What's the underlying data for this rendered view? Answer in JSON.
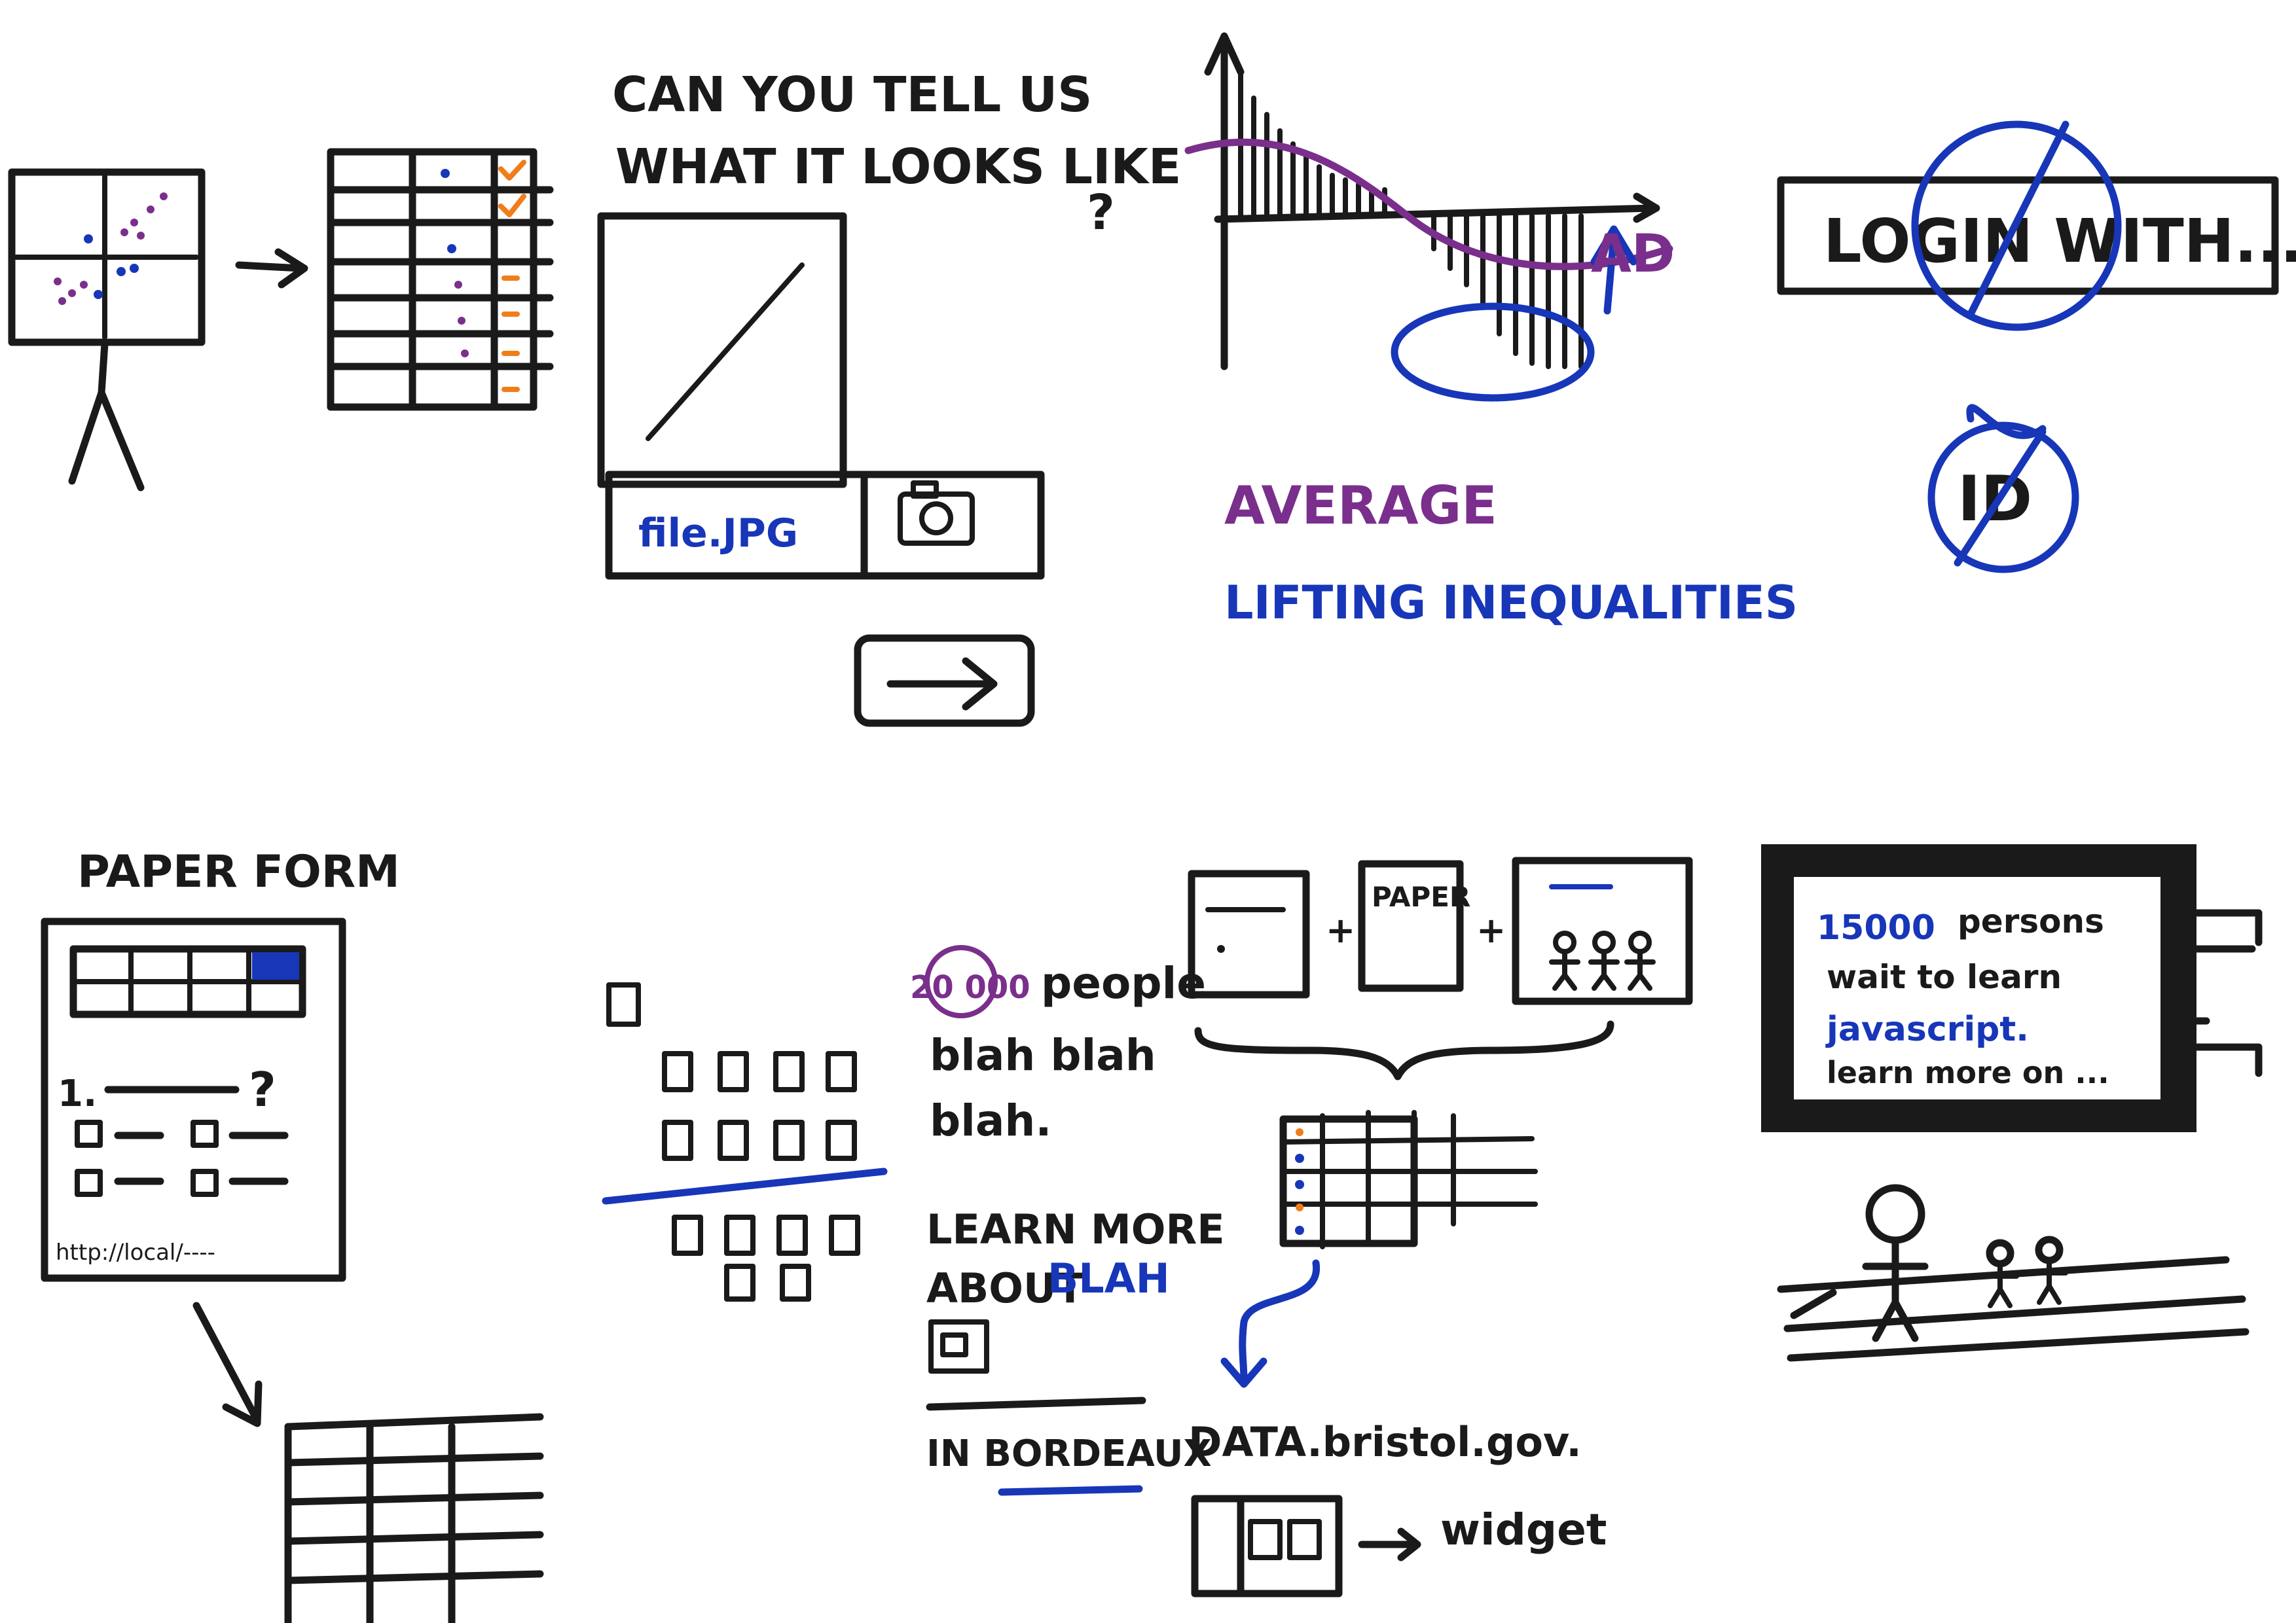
{
  "colors": {
    "ink": "#1a1a1a",
    "blue": "#1736b8",
    "purple": "#7a2f8c",
    "orange": "#f07d1a"
  },
  "sketch1": {
    "question_line1": "CAN YOU TELL US",
    "question_line2": "WHAT IT LOOKS LIKE",
    "question_mark": "?",
    "filename": "file.JPG",
    "camera_icon": "camera-icon",
    "next_icon": "arrow-right-icon"
  },
  "sketch2": {
    "ad_label": "AD",
    "average": "AVERAGE",
    "lifting": "LIFTING INEQUALITIES"
  },
  "sketch3": {
    "login": "LOGIN WITH...",
    "id_label": "ID"
  },
  "sketch4": {
    "title": "PAPER FORM",
    "question_num": "1.",
    "question_mark": "?",
    "url": "http://local/----"
  },
  "sketch5": {
    "number": "20 000",
    "people": "people",
    "blah1": "blah blah",
    "blah2": "blah.",
    "learn_more": "LEARN MORE",
    "about": "ABOUT",
    "blah_link": "BLAH",
    "in_bordeaux": "IN BORDEAUX"
  },
  "sketch6": {
    "box2_label": "PAPER",
    "data_url": "DATA.bristol.gov.",
    "widget": "widget"
  },
  "sketch7": {
    "persons_num": "15000",
    "persons": "persons",
    "wait": "wait to learn",
    "topic": "javascript.",
    "learn": "learn more on ..."
  }
}
